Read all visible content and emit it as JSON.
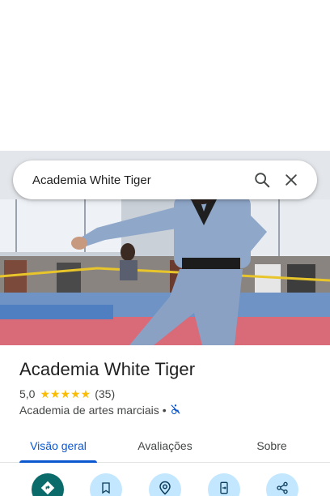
{
  "search": {
    "query": "Academia White Tiger"
  },
  "place": {
    "title": "Academia White Tiger",
    "rating": "5,0",
    "stars": "★★★★★",
    "review_count": "(35)",
    "category": "Academia de artes marciais",
    "separator": "•"
  },
  "tabs": [
    {
      "label": "Visão geral"
    },
    {
      "label": "Avaliações"
    },
    {
      "label": "Sobre"
    }
  ],
  "actions": [
    {
      "icon": "directions-icon"
    },
    {
      "icon": "bookmark-icon"
    },
    {
      "icon": "nearby-icon"
    },
    {
      "icon": "send-to-phone-icon"
    },
    {
      "icon": "share-icon"
    }
  ],
  "colors": {
    "accent": "#0b57d0",
    "star": "#fbbc04",
    "action_bg": "#c2e7ff",
    "primary_action": "#0b6b6b"
  }
}
